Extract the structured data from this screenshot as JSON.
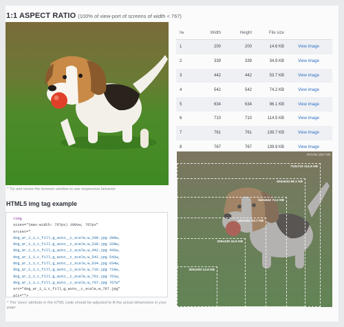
{
  "header": {
    "title": "1:1 ASPECT RATIO",
    "subtitle": "(100% of view-port of screens of width < 767)"
  },
  "photo_note": "* Try and resize the browser window to see responsive behavior",
  "code_section": {
    "title": "HTML5 img tag example",
    "lines": [
      {
        "cls": "tag",
        "text": "<img"
      },
      {
        "cls": "attr",
        "text": "  sizes=\"(max-width: 767px) 100vw, 767px\""
      },
      {
        "cls": "attr",
        "text": "  srcset=\""
      },
      {
        "cls": "str",
        "text": "    dog_ar_1_1,c_fill,g_auto__c_scale,w_200.jpg 200w,"
      },
      {
        "cls": "str",
        "text": "    dog_ar_1_1,c_fill,g_auto__c_scale,w_339.jpg 339w,"
      },
      {
        "cls": "str",
        "text": "    dog_ar_1_1,c_fill,g_auto__c_scale,w_442.jpg 442w,"
      },
      {
        "cls": "str",
        "text": "    dog_ar_1_1,c_fill,g_auto__c_scale,w_542.jpg 542w,"
      },
      {
        "cls": "str",
        "text": "    dog_ar_1_1,c_fill,g_auto__c_scale,w_634.jpg 634w,"
      },
      {
        "cls": "str",
        "text": "    dog_ar_1_1,c_fill,g_auto__c_scale,w_710.jpg 710w,"
      },
      {
        "cls": "str",
        "text": "    dog_ar_1_1,c_fill,g_auto__c_scale,w_761.jpg 761w,"
      },
      {
        "cls": "str",
        "text": "    dog_ar_1_1,c_fill,g_auto__c_scale,w_767.jpg 767w\""
      },
      {
        "cls": "attr",
        "text": "  src=\"dog_ar_1_1,c_fill,g_auto__c_scale,w_767.jpg\""
      },
      {
        "cls": "attr",
        "text": "  alt=\"\">"
      }
    ],
    "note": "* The 'sizes' attribute in the HTML code should be adjusted to fit the actual dimensions in your page"
  },
  "table": {
    "headers": [
      "№",
      "Width",
      "Height",
      "File size",
      ""
    ],
    "rows": [
      {
        "n": "1",
        "w": "200",
        "h": "200",
        "size": "14.6 KB",
        "link": "View image"
      },
      {
        "n": "2",
        "w": "339",
        "h": "339",
        "size": "34.9 KB",
        "link": "View image"
      },
      {
        "n": "3",
        "w": "442",
        "h": "442",
        "size": "53.7 KB",
        "link": "View image"
      },
      {
        "n": "4",
        "w": "542",
        "h": "542",
        "size": "74.2 KB",
        "link": "View image"
      },
      {
        "n": "5",
        "w": "634",
        "h": "634",
        "size": "96.1 KB",
        "link": "View image"
      },
      {
        "n": "6",
        "w": "710",
        "h": "710",
        "size": "114.5 KB",
        "link": "View image"
      },
      {
        "n": "7",
        "w": "761",
        "h": "761",
        "size": "139.7 KB",
        "link": "View image"
      },
      {
        "n": "8",
        "w": "767",
        "h": "767",
        "size": "139.9 KB",
        "link": "View image"
      }
    ]
  },
  "breakpoints": {
    "top_label": "767x761 139.7 KB",
    "boxes": [
      {
        "label": "710x710 114.5 KB",
        "frac": 0.925
      },
      {
        "label": "634x634 96.1 KB",
        "frac": 0.826
      },
      {
        "label": "542x542 74.2 KB",
        "frac": 0.706
      },
      {
        "label": "442x442 53.7 KB",
        "frac": 0.576
      },
      {
        "label": "339x339 34.9 KB",
        "frac": 0.442
      },
      {
        "label": "200x200 14.6 KB",
        "frac": 0.261
      }
    ]
  }
}
